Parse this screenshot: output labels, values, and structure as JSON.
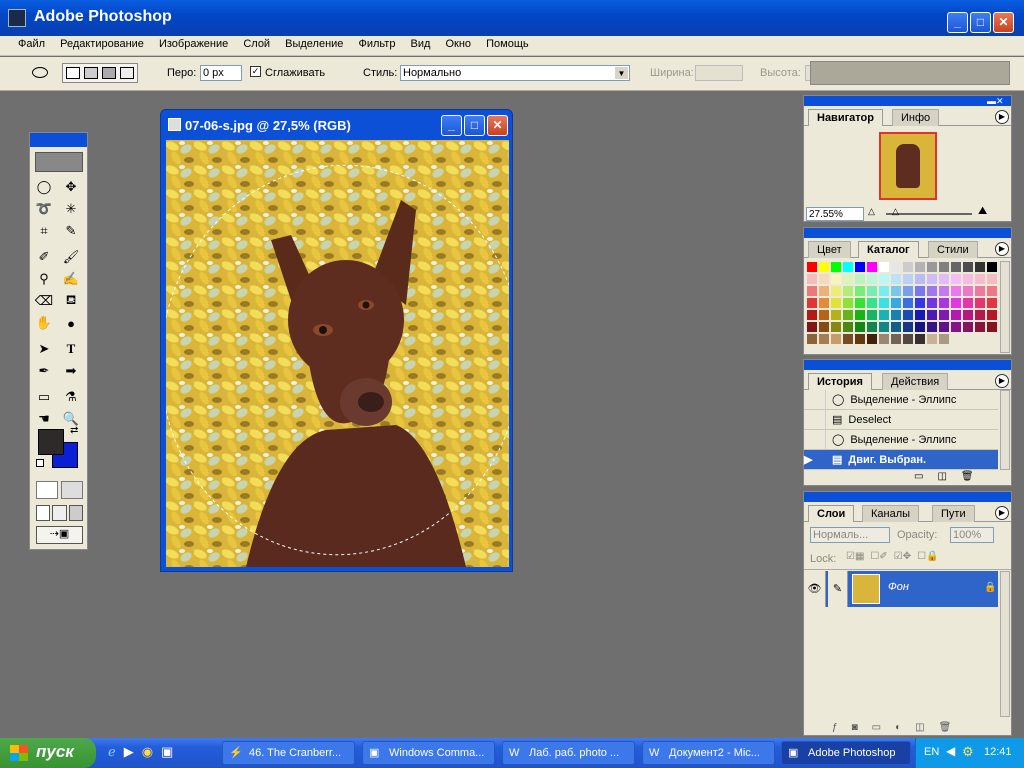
{
  "app": {
    "title": "Adobe Photoshop"
  },
  "menu": [
    "Файл",
    "Редактирование",
    "Изображение",
    "Слой",
    "Выделение",
    "Фильтр",
    "Вид",
    "Окно",
    "Помощь"
  ],
  "options": {
    "feather_label": "Перо:",
    "feather_value": "0 px",
    "antialias_label": "Сглаживать",
    "antialias_checked": "✓",
    "style_label": "Стиль:",
    "style_value": "Нормально",
    "width_label": "Ширина:",
    "height_label": "Высота:"
  },
  "document": {
    "title": "07-06-s.jpg @ 27,5% (RGB)"
  },
  "navigator": {
    "tabs": [
      "Навигатор",
      "Инфо"
    ],
    "zoom": "27.55%"
  },
  "swatches": {
    "tabs": [
      "Цвет",
      "Каталог",
      "Стили"
    ]
  },
  "history": {
    "tabs": [
      "История",
      "Действия"
    ],
    "items": [
      {
        "label": "Выделение - Эллипс"
      },
      {
        "label": "Deselect"
      },
      {
        "label": "Выделение - Эллипс"
      },
      {
        "label": "Двиг. Выбран."
      }
    ]
  },
  "layers": {
    "tabs": [
      "Слои",
      "Каналы",
      "Пути"
    ],
    "blend_mode": "Нормаль...",
    "opacity_label": "Opacity:",
    "opacity_value": "100%",
    "lock_label": "Lock:",
    "layer_name": "Фон"
  },
  "taskbar": {
    "start": "пуск",
    "tasks": [
      {
        "label": "46. The Cranberr..."
      },
      {
        "label": "Windows Comma..."
      },
      {
        "label": "Лаб. раб. photo ..."
      },
      {
        "label": "Документ2 - Mic..."
      },
      {
        "label": "Adobe Photoshop"
      }
    ],
    "lang": "EN",
    "time": "12:41"
  },
  "colors": {
    "foreground": "#2e2a2a",
    "background": "#0b1fd6",
    "selection": "#2f64c8",
    "titlebar": "#0b4ed8"
  }
}
